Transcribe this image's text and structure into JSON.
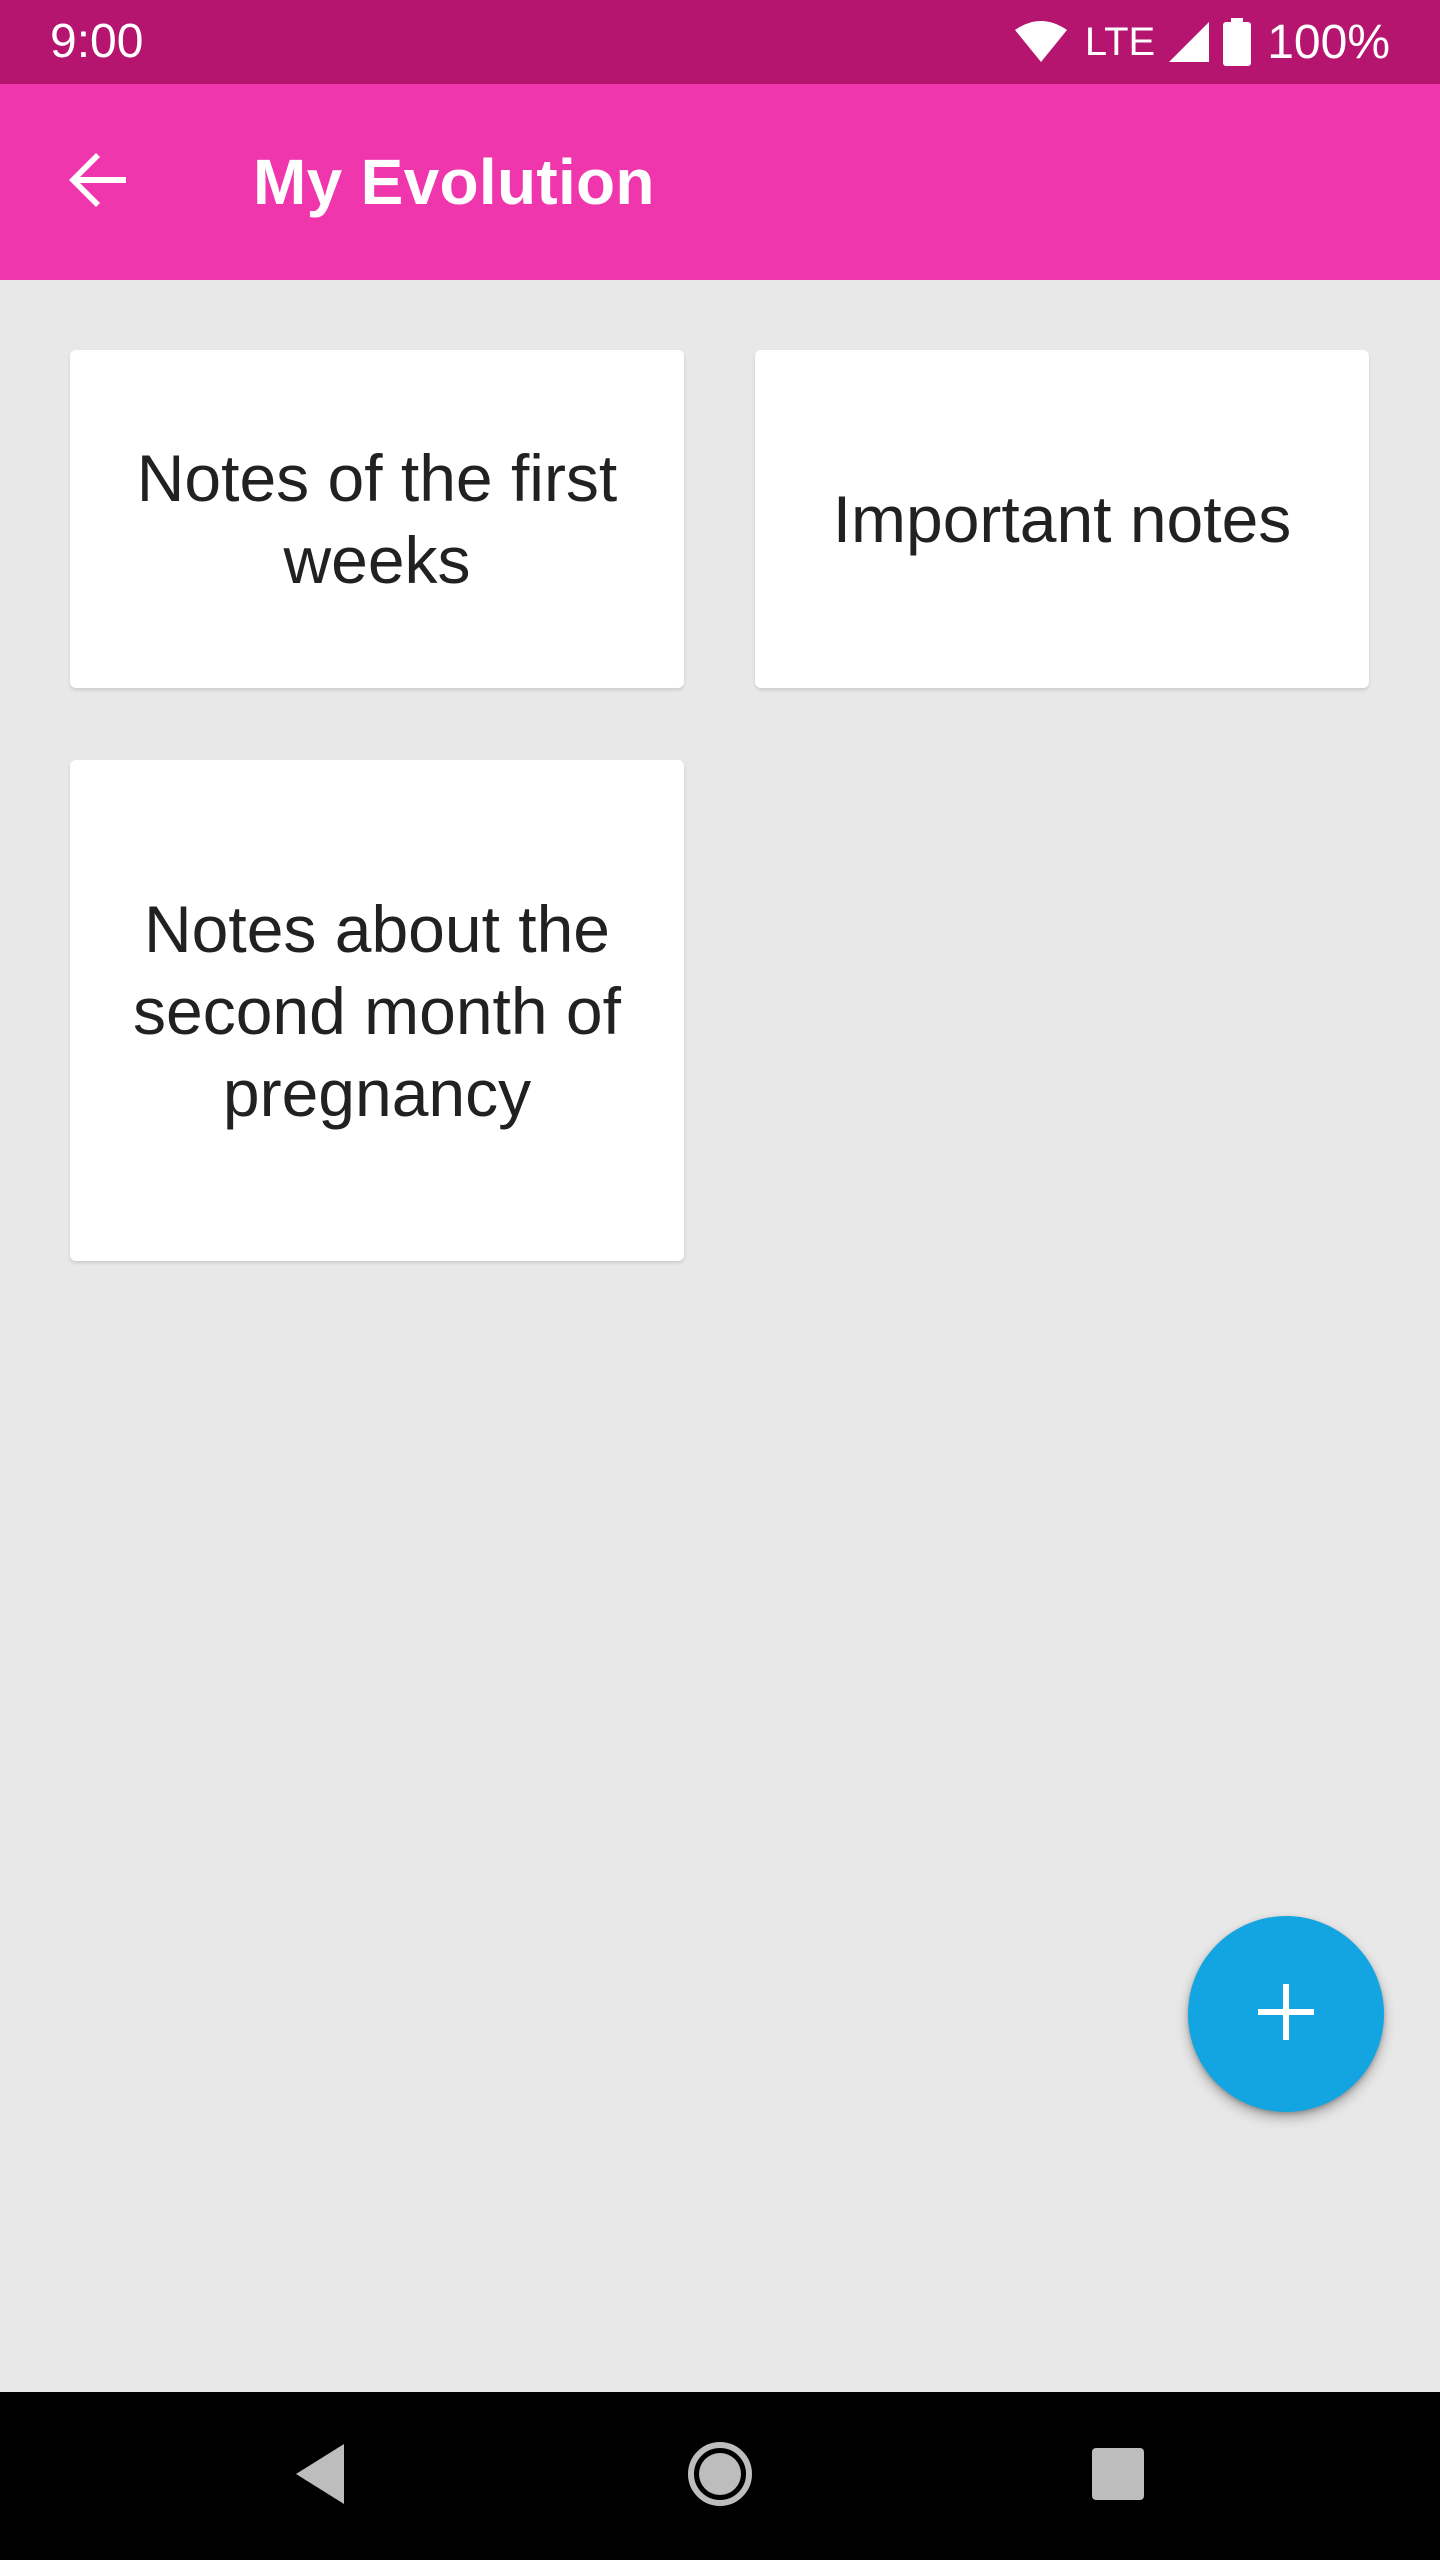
{
  "status_bar": {
    "time": "9:00",
    "network": "LTE",
    "battery": "100%",
    "icons": [
      "wifi-icon",
      "signal-icon",
      "battery-icon"
    ]
  },
  "app_bar": {
    "title": "My Evolution",
    "back_icon": "arrow-back-icon"
  },
  "cards": [
    {
      "label": "Notes of the first weeks"
    },
    {
      "label": "Important notes"
    },
    {
      "label": "Notes about the second month of pregnancy"
    }
  ],
  "fab": {
    "icon": "plus-icon"
  },
  "nav_bar": {
    "icons": [
      "nav-back-icon",
      "nav-home-icon",
      "nav-recents-icon"
    ]
  },
  "colors": {
    "status_bar": "#b5146f",
    "app_bar": "#f036ad",
    "background": "#e8e8e8",
    "card": "#ffffff",
    "fab": "#13a5e1",
    "nav_bar": "#000000"
  }
}
